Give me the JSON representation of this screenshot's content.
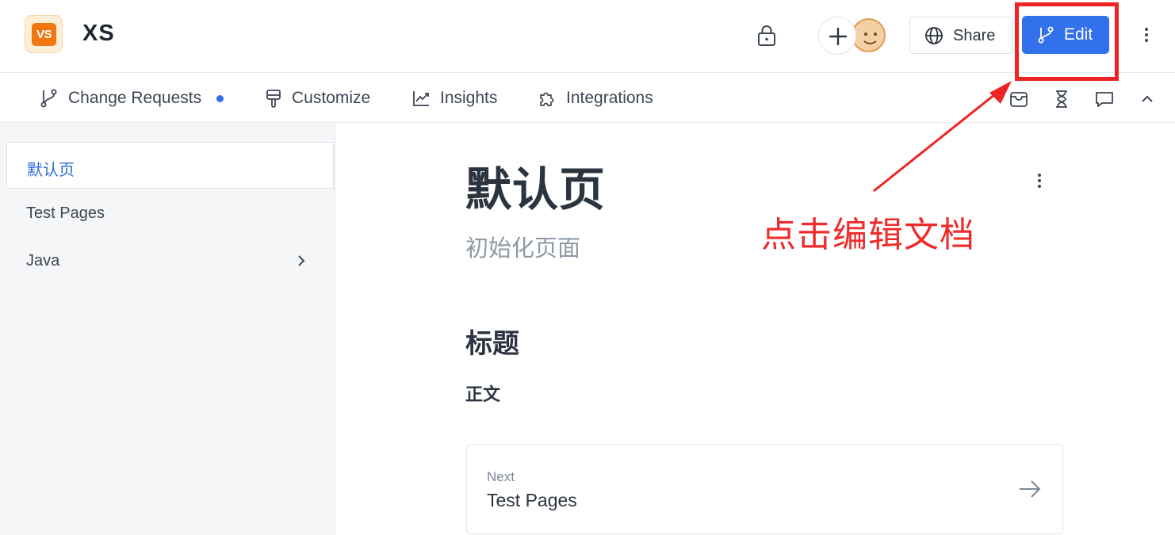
{
  "header": {
    "logo_text": "VS",
    "space_title": "XS",
    "share_label": "Share",
    "edit_label": "Edit"
  },
  "subnav": {
    "items": [
      {
        "label": "Change Requests",
        "icon": "branch-icon",
        "has_dot": true
      },
      {
        "label": "Customize",
        "icon": "brush-icon"
      },
      {
        "label": "Insights",
        "icon": "chart-icon"
      },
      {
        "label": "Integrations",
        "icon": "puzzle-icon"
      }
    ],
    "tools": [
      "inbox-icon",
      "hourglass-icon",
      "comment-icon",
      "chevron-up-icon"
    ]
  },
  "sidebar": {
    "items": [
      {
        "label": "默认页",
        "active": true
      },
      {
        "label": "Test Pages"
      },
      {
        "label": "Java",
        "has_children": true
      }
    ]
  },
  "page": {
    "title": "默认页",
    "description": "初始化页面",
    "heading": "标题",
    "body": "正文",
    "next_label": "Next",
    "next_title": "Test Pages"
  },
  "annotation": {
    "text": "点击编辑文档",
    "color": "#ee2424"
  },
  "colors": {
    "accent": "#3370ec",
    "logo": "#f0760f"
  }
}
